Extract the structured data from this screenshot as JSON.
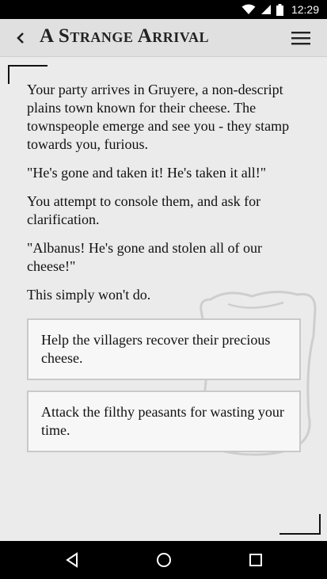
{
  "status_bar": {
    "time": "12:29",
    "icons": [
      "wifi-icon",
      "signal-icon",
      "battery-icon"
    ]
  },
  "app_bar": {
    "title": "A Strange Arrival",
    "back_icon": "chevron-left-icon",
    "menu_icon": "hamburger-menu-icon"
  },
  "story": {
    "paragraphs": [
      "Your party arrives in Gruyere, a non-descript plains town known for their cheese. The townspeople emerge and see you - they stamp towards you, furious.",
      "\"He's gone and taken it! He's taken it all!\"",
      "You attempt to console them, and ask for clarification.",
      "\"Albanus! He's gone and stolen all of our cheese!\"",
      "This simply won't do."
    ]
  },
  "choices": [
    {
      "label": "Help the villagers recover their precious cheese."
    },
    {
      "label": "Attack the filthy peasants for wasting your time."
    }
  ],
  "nav_bar": {
    "icons": [
      "back-triangle-icon",
      "home-circle-icon",
      "recents-square-icon"
    ]
  },
  "colors": {
    "background": "#ebebeb",
    "app_bar": "#e0e0e0",
    "choice_bg": "#f7f7f7",
    "choice_border": "#c9c9c9",
    "text": "#111111"
  }
}
